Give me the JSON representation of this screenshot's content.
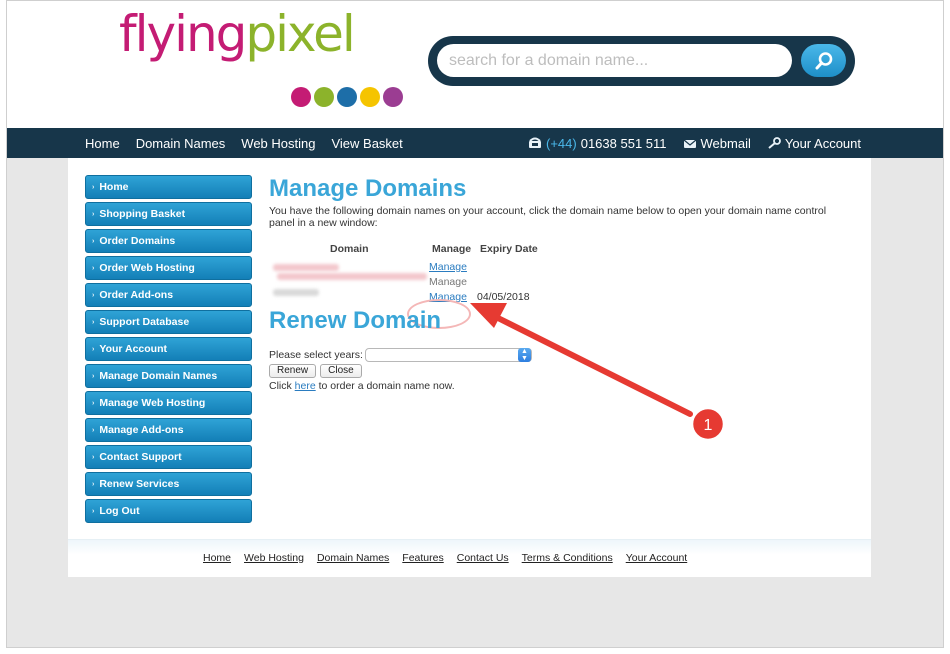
{
  "logo": {
    "part1": "flying",
    "part2": "pixel",
    "dot_colors": [
      "#c41c74",
      "#8cb32b",
      "#1d6ea8",
      "#f5c400",
      "#9b3d92"
    ]
  },
  "search": {
    "placeholder": "search for a domain name..."
  },
  "nav": {
    "items": [
      "Home",
      "Domain Names",
      "Web Hosting",
      "View Basket"
    ],
    "phone_prefix": "(+44)",
    "phone_number": "01638 551 511",
    "webmail": "Webmail",
    "account": "Your Account"
  },
  "sidebar": {
    "items": [
      "Home",
      "Shopping Basket",
      "Order Domains",
      "Order Web Hosting",
      "Order Add-ons",
      "Support Database",
      "Your Account",
      "Manage Domain Names",
      "Manage Web Hosting",
      "Manage Add-ons",
      "Contact Support",
      "Renew Services",
      "Log Out"
    ]
  },
  "main": {
    "title": "Manage Domains",
    "intro": "You have the following domain names on your account, click the domain name below to open your domain name control panel in a new window:",
    "columns": {
      "domain": "Domain",
      "manage": "Manage",
      "expiry": "Expiry Date"
    },
    "rows": [
      {
        "manage": "Manage",
        "expiry": ""
      },
      {
        "manage": "Manage",
        "expiry": ""
      },
      {
        "manage": "Manage",
        "expiry": "04/05/2018"
      }
    ],
    "renew_title": "Renew Domain",
    "select_label": "Please select years:",
    "renew_button": "Renew",
    "close_button": "Close",
    "order_pre": "Click",
    "order_link": "here",
    "order_post": "to order a domain name now."
  },
  "footer": {
    "links": [
      "Home",
      "Web Hosting",
      "Domain Names",
      "Features",
      "Contact Us",
      "Terms & Conditions",
      "Your Account"
    ]
  },
  "annotation": {
    "step": "1",
    "color": "#e63a32"
  }
}
